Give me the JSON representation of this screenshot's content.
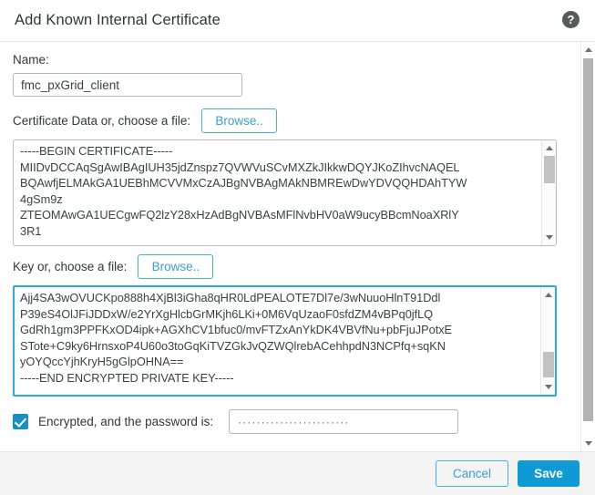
{
  "dialog": {
    "title": "Add Known Internal Certificate",
    "help_icon": "help-circle-icon",
    "help_glyph": "?"
  },
  "form": {
    "name": {
      "label": "Name:",
      "value": "fmc_pxGrid_client",
      "placeholder": ""
    },
    "certificate": {
      "label": "Certificate Data or, choose a file:",
      "browse_label": "Browse..",
      "value": "-----BEGIN CERTIFICATE-----\nMIIDvDCCAqSgAwIBAgIUH35jdZnspz7QVWVuSCvMXZkJIkkwDQYJKoZIhvcNAQEL\nBQAwfjELMAkGA1UEBhMCVVMxCzAJBgNVBAgMAkNBMREwDwYDVQQHDAhTYW\n4gSm9z\nZTEOMAwGA1UECgwFQ2lzY28xHzAdBgNVBAsMFlNvbHV0aW9ucyBBcmNoaXRlY\n3R1"
    },
    "key": {
      "label": "Key or, choose a file:",
      "browse_label": "Browse..",
      "value": "Ajj4SA3wOVUCKpo888h4XjBl3iGha8qHR0LdPEALOTE7Dl7e/3wNuuoHlnT91Ddl\nP39eS4OlJFiJDDxW/e2YrXgHlcbGrMKjh6LKi+0M6VqUzaoF0sfdZM4vBPq0jfLQ\nGdRh1gm3PPFKxOD4ipk+AGXhCV1bfuc0/mvFTZxAnYkDK4VBVfNu+pbFjuJPotxE\nSTote+C9ky6HrnsxoP4U60o3toGqKiTVZGkJvQZWQlrebACehhpdN3NCPfq+sqKN\nyOYQccYjhKryH5gGlpOHNA==\n-----END ENCRYPTED PRIVATE KEY-----"
    },
    "encrypted": {
      "checked": true,
      "label": "Encrypted, and the password is:",
      "password_value": "························",
      "placeholder": ""
    }
  },
  "footer": {
    "cancel_label": "Cancel",
    "save_label": "Save"
  },
  "colors": {
    "accent": "#0f9ad6",
    "link": "#3a9fd8",
    "checkbox": "#1a8fc1",
    "focus_border": "#2fa8e0",
    "footer_bg": "#f4f4f4"
  }
}
